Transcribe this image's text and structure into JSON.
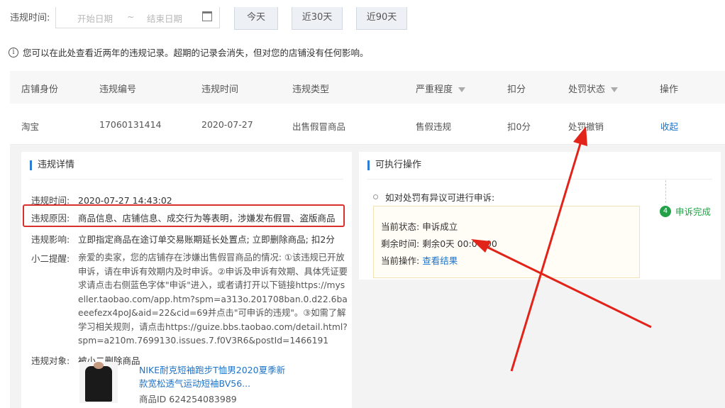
{
  "filter": {
    "label": "违规时间:",
    "date_start_placeholder": "开始日期",
    "date_sep": "~",
    "date_end_placeholder": "结束日期",
    "btn_today": "今天",
    "btn_30": "近30天",
    "btn_90": "近90天"
  },
  "notice": "您可以在此处查看近两年的违规记录。超期的记录会消失，但对您的店铺没有任何影响。",
  "table": {
    "headers": {
      "shop": "店铺身份",
      "id": "违规编号",
      "time": "违规时间",
      "type": "违规类型",
      "severity": "严重程度",
      "points": "扣分",
      "status": "处罚状态",
      "action": "操作"
    },
    "row": {
      "shop": "淘宝",
      "id": "17060131414",
      "time": "2020-07-27",
      "type": "出售假冒商品",
      "severity": "售假违规",
      "points": "扣0分",
      "status": "处罚撤销",
      "action": "收起"
    }
  },
  "detail": {
    "title": "违规详情",
    "time_label": "违规时间:",
    "time_value": "2020-07-27 14:43:02",
    "reason_label": "违规原因:",
    "reason_value": "商品信息、店铺信息、成交行为等表明，涉嫌发布假冒、盗版商品",
    "impact_label": "违规影响:",
    "impact_value": "立即指定商品在途订单交易账期延长处置点; 立即删除商品; 扣2分",
    "tip_label": "小二提醒:",
    "tip_value": "亲爱的卖家，您的店铺存在涉嫌出售假冒商品的情况: ①该违规已开放申诉，请在申诉有效期内及时申诉。②申诉及申诉有效期、具体凭证要求请点击右侧蓝色字体\"申诉\"进入，或者请打开以下链接https://myseller.taobao.com/app.htm?spm=a313o.201708ban.0.d22.6baeeefezx4poJ&aid=22&cid=69并点击\"可申诉的违规\"。③如需了解学习相关规则，请点击https://guize.bbs.taobao.com/detail.html?spm=a210m.7699130.issues.7.f0V3R6&postId=1466191",
    "object_label": "违规对象:",
    "object_value": "被小二删除商品",
    "product_name": "NIKE耐克短袖跑步T恤男2020夏季新款宽松透气运动短袖BV56...",
    "product_id": "商品ID 624254083989"
  },
  "actions": {
    "title": "可执行操作",
    "appeal_question": "如对处罚有异议可进行申诉:",
    "status_label": "当前状态:",
    "status_value": "申诉成立",
    "remain_label": "剩余时间:",
    "remain_value": "剩余0天 00:00:00",
    "op_label": "当前操作:",
    "op_value": "查看结果",
    "step_number": "4",
    "step_label": "申诉完成"
  },
  "colors": {
    "link": "#1e73c8",
    "highlight": "#d9302b",
    "success": "#24a148"
  }
}
